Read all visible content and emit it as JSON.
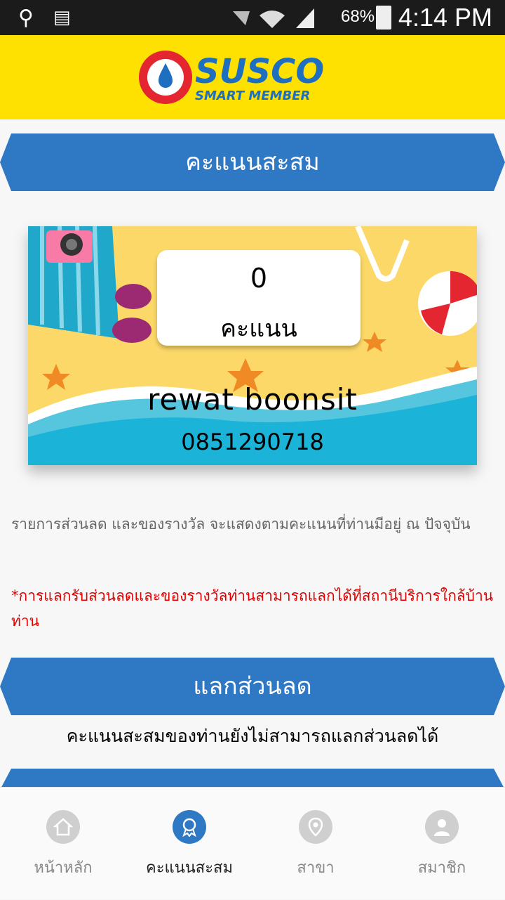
{
  "status_bar": {
    "battery": "68%",
    "time": "4:14 PM"
  },
  "header": {
    "logo_main": "SUSCO",
    "logo_sub": "SMART MEMBER"
  },
  "points_banner": {
    "title": "คะแนนสะสม"
  },
  "card": {
    "points": "0",
    "points_unit": "คะแนน",
    "name": "rewat  boonsit",
    "phone": "0851290718"
  },
  "info": {
    "text": "รายการส่วนลด และของรางวัล จะแสดงตามคะแนนที่ท่านมีอยู่ ณ ปัจจุบัน",
    "note": "*การแลกรับส่วนลดและของรางวัลท่านสามารถแลกได้ที่สถานีบริการใกล้บ้านท่าน"
  },
  "redeem_banner": {
    "title": "แลกส่วนลด",
    "message": "คะแนนสะสมของท่านยังไม่สามารถแลกส่วนลดได้"
  },
  "bottom_nav": {
    "items": [
      {
        "label": "หน้าหลัก",
        "icon": "home-icon",
        "active": false
      },
      {
        "label": "คะแนนสะสม",
        "icon": "award-icon",
        "active": true
      },
      {
        "label": "สาขา",
        "icon": "location-pin-icon",
        "active": false
      },
      {
        "label": "สมาชิก",
        "icon": "user-icon",
        "active": false
      }
    ]
  },
  "colors": {
    "header_yellow": "#ffe100",
    "banner_blue": "#2f79c4",
    "note_red": "#e30000"
  }
}
